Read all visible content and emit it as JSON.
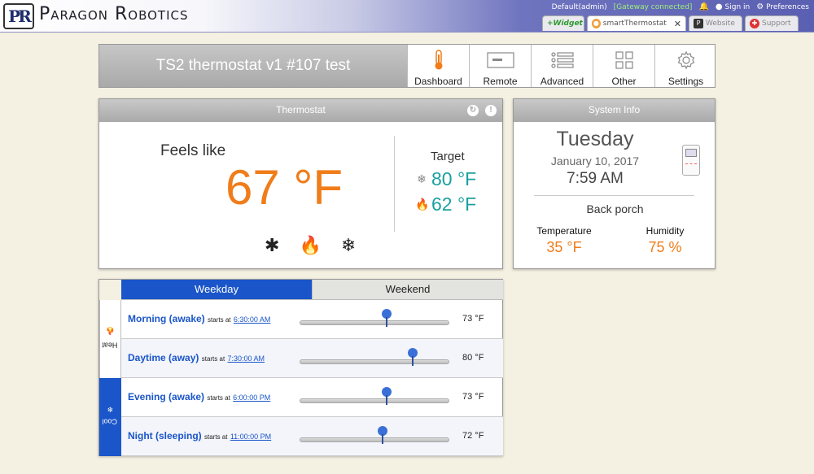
{
  "topbar": {
    "logo_letters": "PR",
    "brand": "Paragon Robotics",
    "user_label": "Default(admin)",
    "gateway_status": "[Gateway connected]",
    "sign_in": "Sign in",
    "preferences": "Preferences",
    "tabs": [
      {
        "label": "+Widget",
        "active": false
      },
      {
        "label": "smartThermostat",
        "active": true
      },
      {
        "label": "Website",
        "active": false
      },
      {
        "label": "Support",
        "active": false
      }
    ]
  },
  "header": {
    "device_title": "TS2 thermostat v1 #107 test",
    "nav": [
      {
        "label": "Dashboard",
        "icon": "thermometer-icon"
      },
      {
        "label": "Remote",
        "icon": "remote-icon"
      },
      {
        "label": "Advanced",
        "icon": "list-icon"
      },
      {
        "label": "Other",
        "icon": "grid-icon"
      },
      {
        "label": "Settings",
        "icon": "gear-icon"
      }
    ]
  },
  "thermostat": {
    "title": "Thermostat",
    "feels_label": "Feels like",
    "feels_value": "67 °F",
    "target_label": "Target",
    "cool_target": "80 °F",
    "heat_target": "62 °F"
  },
  "sysinfo": {
    "title": "System Info",
    "day": "Tuesday",
    "date": "January 10, 2017",
    "time": "7:59 AM",
    "location": "Back porch",
    "temperature_label": "Temperature",
    "temperature_value": "35 °F",
    "humidity_label": "Humidity",
    "humidity_value": "75 %"
  },
  "schedule": {
    "tabs": [
      "Weekday",
      "Weekend"
    ],
    "heat_label": "Heat",
    "cool_label": "Cool",
    "starts_at": "starts at",
    "slider_range": [
      50,
      90
    ],
    "rows": [
      {
        "name": "Morning (awake)",
        "time": "6:30:00 AM",
        "temp": "73 °F",
        "value": 73
      },
      {
        "name": "Daytime (away)",
        "time": "7:30:00 AM",
        "temp": "80 °F",
        "value": 80
      },
      {
        "name": "Evening (awake)",
        "time": "6:00:00 PM",
        "temp": "73 °F",
        "value": 73
      },
      {
        "name": "Night (sleeping)",
        "time": "11:00:00 PM",
        "temp": "72 °F",
        "value": 72
      }
    ]
  },
  "colors": {
    "accent_blue": "#1a55c9",
    "orange": "#f07c1a",
    "teal": "#1ba0a0"
  }
}
